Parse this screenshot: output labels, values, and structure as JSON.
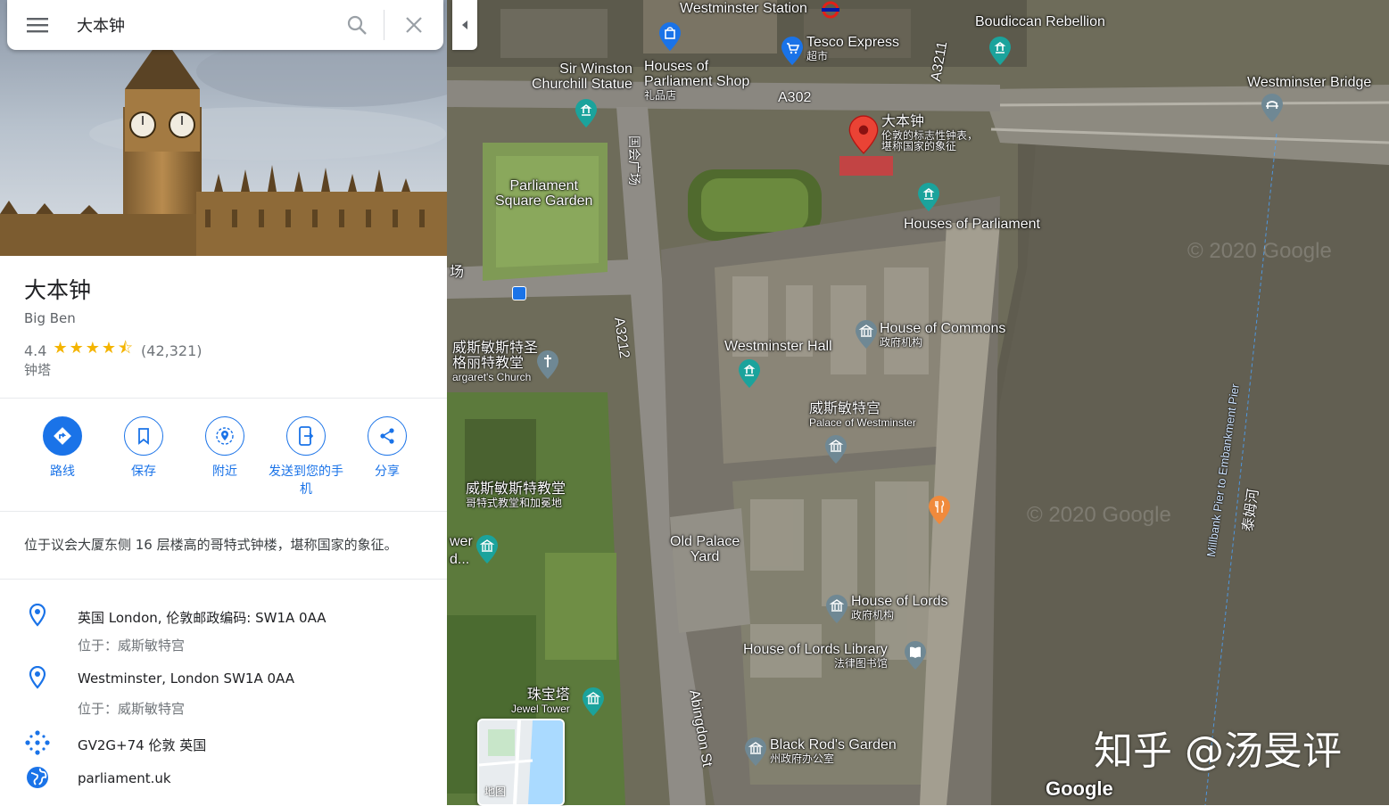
{
  "search": {
    "query": "大本钟"
  },
  "place": {
    "title": "大本钟",
    "subtitle": "Big Ben",
    "rating": "4.4",
    "stars": "★★★★⯪",
    "review_count": "(42,321)",
    "category": "钟塔",
    "description": "位于议会大厦东侧 16 层楼高的哥特式钟楼，堪称国家的象征。"
  },
  "actions": [
    {
      "label": "路线",
      "icon": "directions-icon"
    },
    {
      "label": "保存",
      "icon": "bookmark-icon"
    },
    {
      "label": "附近",
      "icon": "nearby-icon"
    },
    {
      "label": "发送到您的手机",
      "icon": "send-to-phone-icon"
    },
    {
      "label": "分享",
      "icon": "share-icon"
    }
  ],
  "info": [
    {
      "main": "英国 London, 伦敦邮政编码: SW1A 0AA",
      "sub": "位于：威斯敏特宫",
      "icon": "location-pin-icon"
    },
    {
      "main": "Westminster, London SW1A 0AA",
      "sub": "位于：威斯敏特宫",
      "icon": "location-pin-icon"
    },
    {
      "main": "GV2G+74 伦敦 英国",
      "icon": "plus-code-icon"
    },
    {
      "main": "parliament.uk",
      "icon": "globe-icon"
    }
  ],
  "map": {
    "labels": {
      "westminster_station": "Westminster Station",
      "boudiccan": "Boudiccan Rebellion",
      "tesco": "Tesco Express",
      "tesco_sub": "超市",
      "churchill_1": "Sir Winston",
      "churchill_2": "Churchill Statue",
      "parl_shop_1": "Houses of",
      "parl_shop_2": "Parliament Shop",
      "parl_shop_sub": "礼品店",
      "a302": "A302",
      "a3211": "A3211",
      "bigben": "大本钟",
      "bigben_sub1": "伦敦的标志性钟表，",
      "bigben_sub2": "堪称国家的象征",
      "westminster_bridge": "Westminster Bridge",
      "parliament_sq_1": "Parliament",
      "parliament_sq_2": "Square Garden",
      "parl_square_cn": "国会广场",
      "houses_parliament": "Houses of Parliament",
      "house_commons": "House of Commons",
      "house_commons_sub": "政府机构",
      "westminster_hall": "Westminster Hall",
      "a3212": "A3212",
      "st_margaret_1": "威斯敏斯特圣",
      "st_margaret_2": "格丽特教堂",
      "st_margaret_3": "argaret's Church",
      "palace_cn": "威斯敏特宫",
      "palace_en": "Palace of Westminster",
      "abbey_1": "威斯敏斯特教堂",
      "abbey_2": "哥特式教堂和加冕地",
      "old_palace_1": "Old Palace",
      "old_palace_2": "Yard",
      "house_lords": "House of Lords",
      "house_lords_sub": "政府机构",
      "lords_library": "House of Lords Library",
      "lords_library_sub": "法律图书馆",
      "jewel_tower_cn": "珠宝塔",
      "jewel_tower_en": "Jewel Tower",
      "black_rod": "Black Rod's Garden",
      "black_rod_sub": "州政府办公室",
      "abingdon": "Abingdon St",
      "thames": "泰姆河",
      "millbank": "Millbank Pier to Embankment Pier",
      "partial_fang": "场",
      "partial_wer": "wer",
      "partial_d": "d...",
      "copyright": "© 2020 Google"
    },
    "minimap_label": "地图",
    "google_logo": "Google",
    "watermark": "知乎 @汤旻评"
  },
  "colors": {
    "accent": "#1a73e8",
    "pin_red": "#ea4335",
    "poi_teal": "#1ba39c",
    "poi_gray": "#6f8894",
    "poi_orange": "#f08a3c",
    "poi_blue": "#1a73e8",
    "star": "#f4b400"
  }
}
